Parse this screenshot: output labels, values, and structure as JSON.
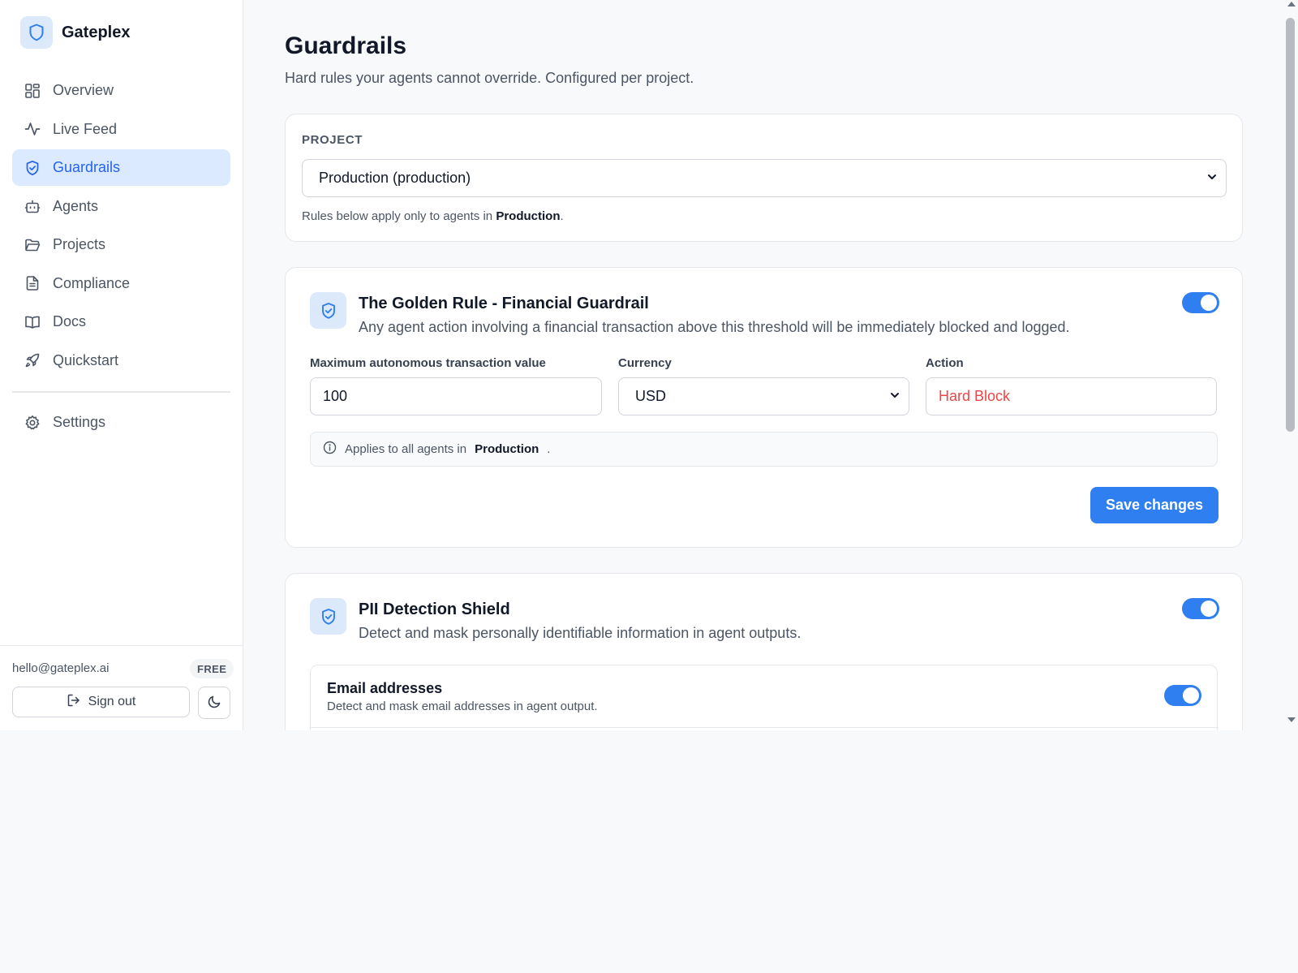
{
  "brand": {
    "name": "Gateplex"
  },
  "sidebar": {
    "items": [
      {
        "label": "Overview",
        "icon": "grid-icon"
      },
      {
        "label": "Live Feed",
        "icon": "activity-icon"
      },
      {
        "label": "Guardrails",
        "icon": "shield-icon",
        "active": true
      },
      {
        "label": "Agents",
        "icon": "bot-icon"
      },
      {
        "label": "Projects",
        "icon": "folder-icon"
      },
      {
        "label": "Compliance",
        "icon": "document-icon"
      },
      {
        "label": "Docs",
        "icon": "book-icon"
      },
      {
        "label": "Quickstart",
        "icon": "rocket-icon"
      }
    ],
    "settings": {
      "label": "Settings",
      "icon": "gear-icon"
    },
    "footer": {
      "email": "hello@gateplex.ai",
      "plan": "FREE",
      "signout_label": "Sign out"
    }
  },
  "page": {
    "title": "Guardrails",
    "subtitle": "Hard rules your agents cannot override. Configured per project."
  },
  "project_card": {
    "label": "PROJECT",
    "selected": "Production (production)",
    "note_prefix": "Rules below apply only to agents in",
    "note_project": "Production",
    "note_suffix": "."
  },
  "rules": [
    {
      "title": "The Golden Rule - Financial Guardrail",
      "description": "Any agent action involving a financial transaction above this threshold will be immediately blocked and logged.",
      "enabled": true,
      "fields": {
        "max_label": "Maximum autonomous transaction value",
        "max_value": "100",
        "currency_label": "Currency",
        "currency_value": "USD",
        "action_label": "Action",
        "action_value": "Hard Block"
      },
      "info_prefix": "Applies to all agents in",
      "info_project": "Production",
      "info_suffix": ".",
      "save_label": "Save changes"
    },
    {
      "title": "PII Detection Shield",
      "description": "Detect and mask personally identifiable information in agent outputs.",
      "enabled": true,
      "sub_rules": [
        {
          "title": "Email addresses",
          "description": "Detect and mask email addresses in agent output.",
          "enabled": true
        }
      ]
    }
  ],
  "colors": {
    "accent": "#2f7ff0",
    "active_nav_bg": "#dbeafe",
    "danger_text": "#ef4444"
  }
}
